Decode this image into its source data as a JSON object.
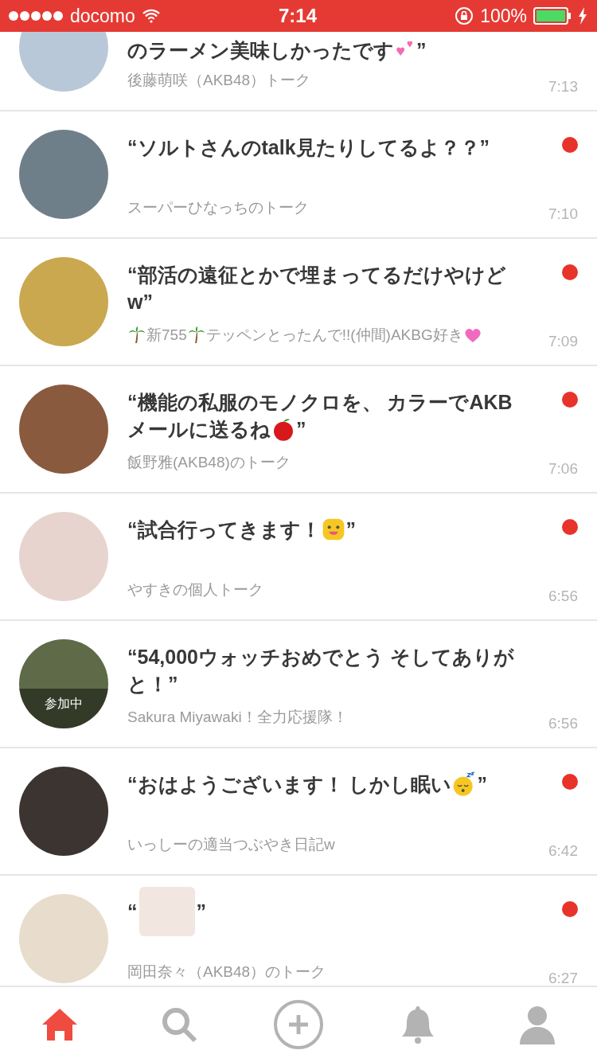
{
  "status_bar": {
    "carrier": "docomo",
    "time": "7:14",
    "battery": "100%"
  },
  "rows": [
    {
      "partial": true,
      "title_lines": [
        [
          {
            "kind": "text",
            "text": "のラーメン美味しかったです"
          },
          {
            "kind": "hearts"
          },
          {
            "kind": "text",
            "text": "”"
          }
        ]
      ],
      "subtitle": [
        {
          "kind": "text",
          "text": "後藤萌咲（AKB48）トーク"
        }
      ],
      "time": "7:13"
    },
    {
      "partial": false,
      "unread": true,
      "title_lines": [
        [
          {
            "kind": "text",
            "text": "“ソルトさんのtalk見たりしてるよ？？”"
          }
        ]
      ],
      "subtitle": [
        {
          "kind": "text",
          "text": "スーパーひなっちのトーク"
        }
      ],
      "time": "7:10"
    },
    {
      "partial": false,
      "unread": true,
      "title_lines": [
        [
          {
            "kind": "text",
            "text": "“部活の遠征とかで埋まってるだけやけど"
          }
        ],
        [
          {
            "kind": "text",
            "text": "w”"
          }
        ]
      ],
      "subtitle": [
        {
          "kind": "palm"
        },
        {
          "kind": "text",
          "text": "新755"
        },
        {
          "kind": "palm"
        },
        {
          "kind": "text",
          "text": "テッペンとったんで!!(仲間)AKBG好き"
        },
        {
          "kind": "heart"
        }
      ],
      "time": "7:09"
    },
    {
      "partial": false,
      "unread": true,
      "title_lines": [
        [
          {
            "kind": "text",
            "text": "“機能の私服のモノクロを、 カラーでAKB"
          }
        ],
        [
          {
            "kind": "text",
            "text": "メールに送るね"
          },
          {
            "kind": "apple"
          },
          {
            "kind": "text",
            "text": "”"
          }
        ]
      ],
      "subtitle": [
        {
          "kind": "text",
          "text": "飯野雅(AKB48)のトーク"
        }
      ],
      "time": "7:06"
    },
    {
      "partial": false,
      "unread": true,
      "title_lines": [
        [
          {
            "kind": "text",
            "text": "“試合行ってきます！"
          },
          {
            "kind": "face"
          },
          {
            "kind": "text",
            "text": "”"
          }
        ]
      ],
      "subtitle": [
        {
          "kind": "text",
          "text": "やすきの個人トーク"
        }
      ],
      "time": "6:56"
    },
    {
      "partial": false,
      "unread": false,
      "avatar_badge": "参加中",
      "title_lines": [
        [
          {
            "kind": "text",
            "text": "“54,000ウォッチおめでとう そしてありが"
          }
        ],
        [
          {
            "kind": "text",
            "text": "と！”"
          }
        ]
      ],
      "subtitle": [
        {
          "kind": "text",
          "text": "Sakura Miyawaki！全力応援隊！"
        }
      ],
      "time": "6:56"
    },
    {
      "partial": false,
      "unread": true,
      "title_lines": [
        [
          {
            "kind": "text",
            "text": "“おはようございます！ しかし眠い"
          },
          {
            "kind": "sleepy"
          },
          {
            "kind": "text",
            "text": "”"
          }
        ]
      ],
      "subtitle": [
        {
          "kind": "text",
          "text": "いっしーの適当つぶやき日記w"
        }
      ],
      "time": "6:42"
    },
    {
      "partial": false,
      "unread": true,
      "title_lines": [
        [
          {
            "kind": "text",
            "text": "“"
          },
          {
            "kind": "sticker"
          },
          {
            "kind": "text",
            "text": "”"
          }
        ]
      ],
      "subtitle": [
        {
          "kind": "text",
          "text": "岡田奈々（AKB48）のトーク"
        }
      ],
      "time": "6:27"
    }
  ],
  "tabs": [
    {
      "kind": "home",
      "selected": true
    },
    {
      "kind": "search",
      "selected": false
    },
    {
      "kind": "post",
      "selected": false
    },
    {
      "kind": "notifications",
      "selected": false
    },
    {
      "kind": "profile",
      "selected": false
    }
  ]
}
